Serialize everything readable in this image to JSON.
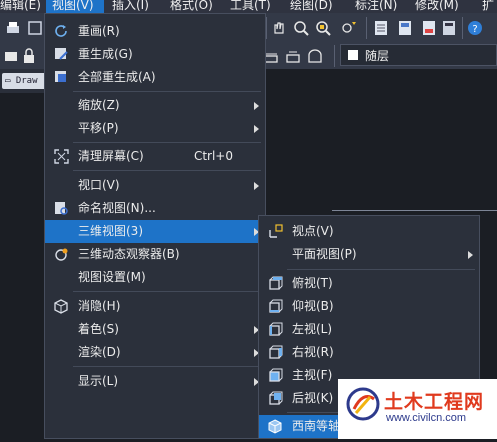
{
  "menubar": {
    "items": [
      {
        "label": "编辑(E)"
      },
      {
        "label": "视图(V)"
      },
      {
        "label": "插入(I)"
      },
      {
        "label": "格式(O)"
      },
      {
        "label": "工具(T)"
      },
      {
        "label": "绘图(D)"
      },
      {
        "label": "标注(N)"
      },
      {
        "label": "修改(M)"
      },
      {
        "label": "扩"
      }
    ]
  },
  "toolbar": {
    "layer_name": "随层"
  },
  "drawing_tab": {
    "label": "Draw"
  },
  "view_menu": {
    "items": [
      {
        "label": "重画(R)"
      },
      {
        "label": "重生成(G)"
      },
      {
        "label": "全部重生成(A)"
      },
      {
        "label": "缩放(Z)"
      },
      {
        "label": "平移(P)"
      },
      {
        "label": "清理屏幕(C)",
        "shortcut": "Ctrl+0"
      },
      {
        "label": "视口(V)"
      },
      {
        "label": "命名视图(N)..."
      },
      {
        "label": "三维视图(3)"
      },
      {
        "label": "三维动态观察器(B)"
      },
      {
        "label": "视图设置(M)"
      },
      {
        "label": "消隐(H)"
      },
      {
        "label": "着色(S)"
      },
      {
        "label": "渲染(D)"
      },
      {
        "label": "显示(L)"
      }
    ]
  },
  "submenu_3d": {
    "items": [
      {
        "label": "视点(V)"
      },
      {
        "label": "平面视图(P)"
      },
      {
        "label": "俯视(T)"
      },
      {
        "label": "仰视(B)"
      },
      {
        "label": "左视(L)"
      },
      {
        "label": "右视(R)"
      },
      {
        "label": "主视(F)"
      },
      {
        "label": "后视(K)"
      },
      {
        "label": "西南等轴"
      }
    ]
  },
  "watermark": {
    "title": "土木工程网",
    "url": "www.civilcn.com"
  },
  "colors": {
    "highlight": "#1e73c8",
    "menu_bg": "#2b303b",
    "watermark_title": "#e03a1e"
  }
}
